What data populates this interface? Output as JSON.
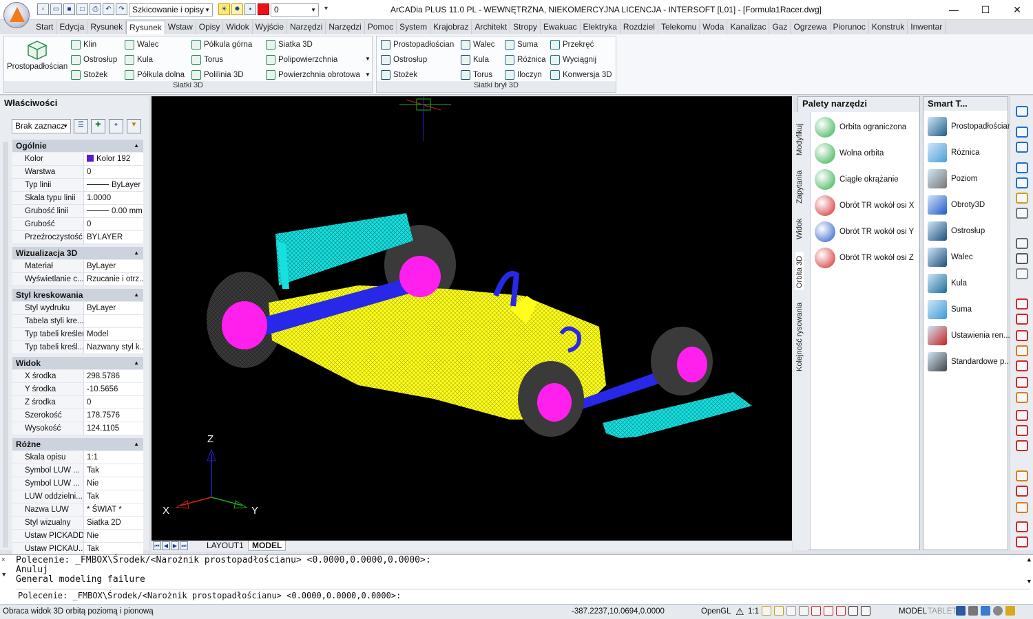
{
  "titlebar": {
    "workspace": "Szkicowanie i opisy",
    "layer": "0",
    "title": "ArCADia PLUS 11.0 PL - WEWNĘTRZNA, NIEKOMERCYJNA LICENCJA - INTERSOFT [L01] - [Formula1Racer.dwg]",
    "qat_icons": [
      "new-icon",
      "open-icon",
      "save-icon",
      "saveas-icon",
      "print-icon",
      "undo-icon",
      "redo-icon"
    ]
  },
  "tabs": [
    "Start",
    "Edycja",
    "Rysunek",
    "Rysunek",
    "Wstaw",
    "Opisy",
    "Widok",
    "Wyjście",
    "Narzędzi",
    "Narzędzi",
    "Pomoc",
    "System",
    "Krajobraz",
    "Architekt",
    "Stropy",
    "Ewakuac",
    "Elektryka",
    "Rozdziel",
    "Telekomu",
    "Woda",
    "Kanalizac",
    "Gaz",
    "Ogrzewa",
    "Piorunoc",
    "Konstruk",
    "Inwentar"
  ],
  "active_tab": 3,
  "ribbon": {
    "big_button": "Prostopadłościan",
    "g1_col1": [
      "Klin",
      "Ostrosłup",
      "Stożek"
    ],
    "g1_col2": [
      "Walec",
      "Kula",
      "Półkula dolna"
    ],
    "g1_col3": [
      "Półkula górna",
      "Torus",
      "Polilinia 3D"
    ],
    "g1_col4": [
      "Siatka 3D",
      "Polipowierzchnia",
      "Powierzchnia obrotowa"
    ],
    "group1": "Siatki 3D",
    "g2_col1": [
      "Prostopadłościan",
      "Ostrosłup",
      "Stożek"
    ],
    "g2_col2": [
      "Walec",
      "Kula",
      "Torus"
    ],
    "g2_col3": [
      "Suma",
      "Różnica",
      "Iloczyn"
    ],
    "g2_col4": [
      "Przekręć",
      "Wyciągnij",
      "Konwersja 3D"
    ],
    "group2": "Siatki brył 3D"
  },
  "properties": {
    "title": "Właściwości",
    "selection": "Brak zaznacz",
    "sections": [
      {
        "name": "Ogólnie",
        "rows": [
          [
            "Kolor",
            "Kolor 192"
          ],
          [
            "Warstwa",
            "0"
          ],
          [
            "Typ linii",
            "ByLayer"
          ],
          [
            "Skala typu linii",
            "1.0000"
          ],
          [
            "Grubość linii",
            "0.00 mm"
          ],
          [
            "Grubość",
            "0"
          ],
          [
            "Przeźroczystość",
            "BYLAYER"
          ]
        ]
      },
      {
        "name": "Wizualizacja 3D",
        "rows": [
          [
            "Materiał",
            "ByLayer"
          ],
          [
            "Wyświetlanie c...",
            "Rzucanie i otrz..."
          ]
        ]
      },
      {
        "name": "Styl kreskowania",
        "rows": [
          [
            "Styl wydruku",
            "ByLayer"
          ],
          [
            "Tabela styli kre...",
            ""
          ],
          [
            "Typ tabeli kreśleni...",
            "Model"
          ],
          [
            "Typ tabeli kreśl...",
            "Nazwany styl k..."
          ]
        ]
      },
      {
        "name": "Widok",
        "rows": [
          [
            "X środka",
            "298.5786"
          ],
          [
            "Y środka",
            "-10.5656"
          ],
          [
            "Z środka",
            "0"
          ],
          [
            "Szerokość",
            "178.7576"
          ],
          [
            "Wysokość",
            "124.1105"
          ]
        ]
      },
      {
        "name": "Różne",
        "rows": [
          [
            "Skala opisu",
            "1:1"
          ],
          [
            "Symbol LUW ...",
            "Tak"
          ],
          [
            "Symbol LUW ...",
            "Nie"
          ],
          [
            "LUW oddzielni...",
            "Tak"
          ],
          [
            "Nazwa LUW",
            "* ŚWIAT *"
          ],
          [
            "Styl wizualny",
            "Siatka 2D"
          ],
          [
            "Ustaw PICKADD",
            "Nie"
          ],
          [
            "Ustaw PICKAU...",
            "Tak"
          ]
        ]
      }
    ],
    "swatch_color": "#5a1ccc"
  },
  "viewport": {
    "axis_x": "X",
    "axis_y": "Y",
    "axis_z": "Z",
    "layout_tabs": [
      "LAYOUT1",
      "MODEL"
    ]
  },
  "palettes": {
    "title": "Palety narzędzi",
    "vtabs": [
      "Modyfikuj",
      "Zapytania",
      "Widok",
      "Orbita 3D",
      "Kolejność rysowania"
    ],
    "items": [
      "Orbita ograniczona",
      "Wolna orbita",
      "Ciągłe okrążanie",
      "Obrót TR wokół osi X",
      "Obrót TR wokół osi Y",
      "Obrót TR wokół osi Z"
    ]
  },
  "smart": {
    "title": "Smart T...",
    "items": [
      "Prostopadłościan",
      "Różnica",
      "Poziom",
      "Obroty3D",
      "Ostrosłup",
      "Walec",
      "Kula",
      "Suma",
      "Ustawienia ren...",
      "Standardowe p..."
    ]
  },
  "command": {
    "lines": [
      "Polecenie: _FMBOX\\Środek/<Narożnik prostopadłościanu> <0.0000,0.0000,0.0000>:",
      "Anuluj",
      "General modeling failure"
    ],
    "prompt": "Polecenie: _FMBOX\\Środek/<Narożnik prostopadłościanu> <0.0000,0.0000,0.0000>:"
  },
  "status": {
    "hint": "Obraca widok 3D orbitą poziomą i pionową",
    "coords": "-387.2237,10.0694,0.0000",
    "renderer": "OpenGL",
    "scale": "1:1",
    "model": "MODEL",
    "tablet": "TABLET"
  }
}
